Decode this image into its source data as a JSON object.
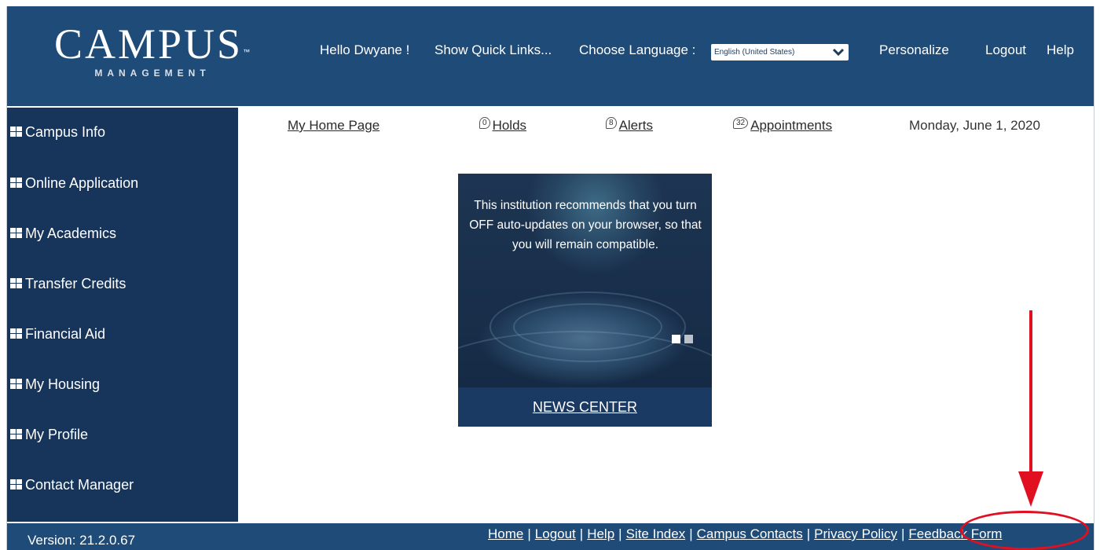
{
  "header": {
    "logo_main": "CAMPUS",
    "logo_tm": "™",
    "logo_sub": "MANAGEMENT",
    "greeting": "Hello Dwyane !",
    "quick_links": "Show Quick Links...",
    "language_label": "Choose Language :",
    "language_value": "English (United States)",
    "personalize": "Personalize",
    "logout": "Logout",
    "help": "Help"
  },
  "sidebar": {
    "items": [
      {
        "label": "Campus Info"
      },
      {
        "label": "Online Application"
      },
      {
        "label": "My Academics"
      },
      {
        "label": "Transfer Credits"
      },
      {
        "label": "Financial Aid"
      },
      {
        "label": "My Housing"
      },
      {
        "label": "My Profile"
      },
      {
        "label": "Contact Manager"
      }
    ]
  },
  "topnav": {
    "home": "My Home Page",
    "holds_count": "0",
    "holds": "Holds",
    "alerts_count": "8",
    "alerts": "Alerts",
    "appointments_count": "32",
    "appointments": "Appointments",
    "date": "Monday, June 1, 2020"
  },
  "news": {
    "message": "This institution recommends that you turn OFF auto-updates on your browser, so that you will remain compatible.",
    "footer_link": "NEWS CENTER",
    "slide_dots": {
      "active": 1,
      "total": 2
    }
  },
  "footer": {
    "version": "Version: 21.2.0.67",
    "links": [
      "Home",
      "Logout",
      "Help",
      "Site Index",
      "Campus Contacts",
      "Privacy Policy",
      "Feedback Form"
    ],
    "separator": "|"
  },
  "colors": {
    "header_bg": "#1f4b78",
    "sidebar_bg": "#17355b",
    "annotation": "#e01020"
  }
}
